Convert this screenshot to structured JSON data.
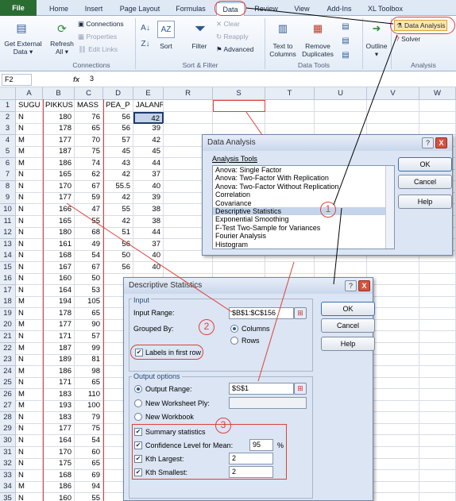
{
  "tabs": [
    "File",
    "Home",
    "Insert",
    "Page Layout",
    "Formulas",
    "Data",
    "Review",
    "View",
    "Add-Ins",
    "XL Toolbox"
  ],
  "ribbon": {
    "get_external": "Get External",
    "data": "Data",
    "refresh": "Refresh",
    "all": "All",
    "connections": "Connections",
    "properties": "Properties",
    "edit_links": "Edit Links",
    "connections_group": "Connections",
    "sort": "Sort",
    "filter": "Filter",
    "clear": "Clear",
    "reapply": "Reapply",
    "advanced": "Advanced",
    "sort_filter_group": "Sort & Filter",
    "text_to": "Text to",
    "columns": "Columns",
    "remove": "Remove",
    "duplicates": "Duplicates",
    "data_tools_group": "Data Tools",
    "outline": "Outline",
    "data_analysis": "Data Analysis",
    "solver": "Solver",
    "analysis_group": "Analysis"
  },
  "formula_bar": {
    "name_box": "F2",
    "fx": "fx",
    "value": "3"
  },
  "sheet": {
    "columns": [
      "A",
      "B",
      "C",
      "D",
      "E",
      "R",
      "S",
      "T",
      "U",
      "V",
      "W"
    ],
    "headers": [
      "SUGU",
      "PIKKUS",
      "MASS",
      "PEA_P",
      "JALANR"
    ],
    "rows": [
      [
        "1",
        "SUGU",
        "PIKKUS",
        "MASS",
        "PEA_P",
        "JALANR"
      ],
      [
        "2",
        "N",
        "180",
        "76",
        "56",
        "42"
      ],
      [
        "3",
        "N",
        "178",
        "65",
        "56",
        "39"
      ],
      [
        "4",
        "M",
        "177",
        "70",
        "57",
        "42"
      ],
      [
        "5",
        "M",
        "187",
        "75",
        "45",
        "45"
      ],
      [
        "6",
        "M",
        "186",
        "74",
        "43",
        "44"
      ],
      [
        "7",
        "N",
        "165",
        "62",
        "42",
        "37"
      ],
      [
        "8",
        "N",
        "170",
        "67",
        "55.5",
        "40"
      ],
      [
        "9",
        "N",
        "177",
        "59",
        "42",
        "39"
      ],
      [
        "10",
        "N",
        "166",
        "47",
        "55",
        "38"
      ],
      [
        "11",
        "N",
        "165",
        "55",
        "42",
        "38"
      ],
      [
        "12",
        "N",
        "180",
        "68",
        "51",
        "44"
      ],
      [
        "13",
        "N",
        "161",
        "49",
        "56",
        "37"
      ],
      [
        "14",
        "N",
        "168",
        "54",
        "50",
        "40"
      ],
      [
        "15",
        "N",
        "167",
        "67",
        "56",
        "40"
      ],
      [
        "16",
        "N",
        "160",
        "50",
        "",
        ""
      ],
      [
        "17",
        "N",
        "164",
        "53",
        "",
        ""
      ],
      [
        "18",
        "M",
        "194",
        "105",
        "",
        ""
      ],
      [
        "19",
        "N",
        "178",
        "65",
        "",
        ""
      ],
      [
        "20",
        "M",
        "177",
        "90",
        "",
        ""
      ],
      [
        "21",
        "N",
        "171",
        "57",
        "",
        ""
      ],
      [
        "22",
        "M",
        "187",
        "99",
        "",
        ""
      ],
      [
        "23",
        "N",
        "189",
        "81",
        "",
        ""
      ],
      [
        "24",
        "M",
        "186",
        "98",
        "",
        ""
      ],
      [
        "25",
        "N",
        "171",
        "65",
        "",
        ""
      ],
      [
        "26",
        "M",
        "183",
        "110",
        "",
        ""
      ],
      [
        "27",
        "M",
        "193",
        "100",
        "",
        ""
      ],
      [
        "28",
        "N",
        "183",
        "79",
        "",
        ""
      ],
      [
        "29",
        "N",
        "177",
        "75",
        "",
        ""
      ],
      [
        "30",
        "N",
        "164",
        "54",
        "",
        ""
      ],
      [
        "31",
        "N",
        "170",
        "60",
        "",
        ""
      ],
      [
        "32",
        "N",
        "175",
        "65",
        "",
        ""
      ],
      [
        "33",
        "N",
        "168",
        "69",
        "",
        ""
      ],
      [
        "34",
        "M",
        "186",
        "94",
        "",
        ""
      ],
      [
        "35",
        "N",
        "160",
        "55",
        "",
        ""
      ]
    ]
  },
  "data_analysis_dialog": {
    "title": "Data Analysis",
    "help_btn": "?",
    "close_btn": "X",
    "tools_label": "Analysis Tools",
    "tools": [
      "Anova: Single Factor",
      "Anova: Two-Factor With Replication",
      "Anova: Two-Factor Without Replication",
      "Correlation",
      "Covariance",
      "Descriptive Statistics",
      "Exponential Smoothing",
      "F-Test Two-Sample for Variances",
      "Fourier Analysis",
      "Histogram"
    ],
    "selected_tool": "Descriptive Statistics",
    "ok": "OK",
    "cancel": "Cancel",
    "help": "Help"
  },
  "descriptive_dialog": {
    "title": "Descriptive Statistics",
    "input_group": "Input",
    "input_range_label": "Input Range:",
    "input_range": "$B$1:$C$156",
    "grouped_by_label": "Grouped By:",
    "columns": "Columns",
    "rows": "Rows",
    "labels_first_row": "Labels in first row",
    "output_group": "Output options",
    "output_range_label": "Output Range:",
    "output_range": "$S$1",
    "new_ply": "New Worksheet Ply:",
    "new_workbook": "New Workbook",
    "summary_stats": "Summary statistics",
    "confidence_label": "Confidence Level for Mean:",
    "confidence_value": "95",
    "percent": "%",
    "kth_largest": "Kth Largest:",
    "kth_largest_value": "2",
    "kth_smallest": "Kth Smallest:",
    "kth_smallest_value": "2",
    "ok": "OK",
    "cancel": "Cancel",
    "help": "Help"
  },
  "annotations": [
    "1",
    "2",
    "3"
  ],
  "colors": {
    "annotation": "#e0403a",
    "file_tab": "#2a6d33",
    "selection": "#c5d4ea"
  }
}
